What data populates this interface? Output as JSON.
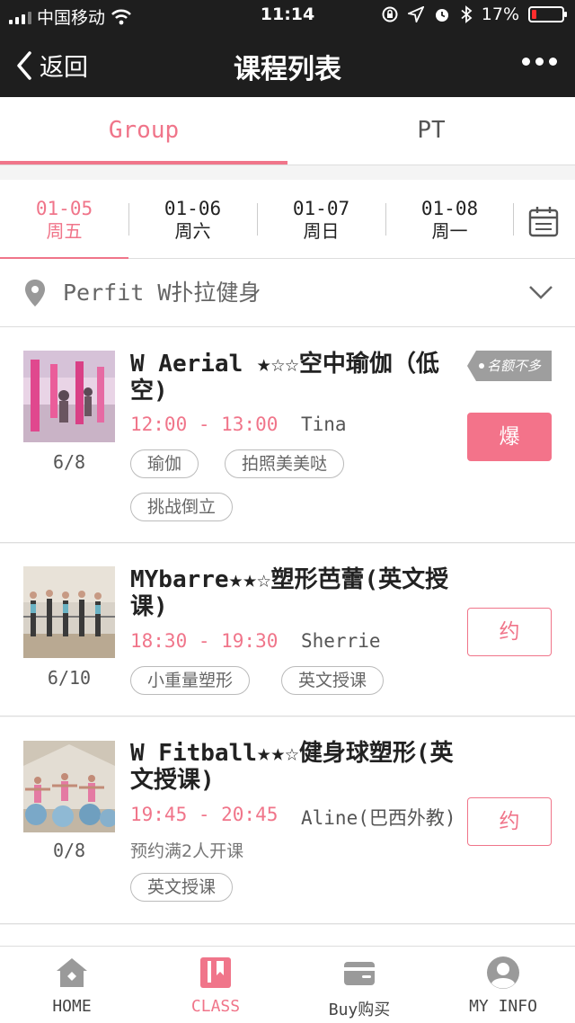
{
  "status_bar": {
    "carrier": "中国移动",
    "time": "11:14",
    "battery": "17%",
    "battery_fraction": 0.17
  },
  "nav": {
    "back_label": "返回",
    "title": "课程列表"
  },
  "tabs": [
    {
      "label": "Group",
      "active": true
    },
    {
      "label": "PT",
      "active": false
    }
  ],
  "dates": [
    {
      "date": "01-05",
      "weekday": "周五",
      "active": true
    },
    {
      "date": "01-06",
      "weekday": "周六",
      "active": false
    },
    {
      "date": "01-07",
      "weekday": "周日",
      "active": false
    },
    {
      "date": "01-08",
      "weekday": "周一",
      "active": false
    }
  ],
  "location": {
    "name": "Perfit W扑拉健身"
  },
  "courses": [
    {
      "title": "W Aerial ★☆☆空中瑜伽（低空)",
      "time": "12:00 - 13:00",
      "coach": "Tina",
      "count": "6/8",
      "badge": "名额不多",
      "button": "爆",
      "tags": [
        "瑜伽",
        "拍照美美哒",
        "挑战倒立"
      ]
    },
    {
      "title": "MYbarre★★☆塑形芭蕾(英文授课)",
      "time": "18:30 - 19:30",
      "coach": "Sherrie",
      "count": "6/10",
      "button": "约",
      "tags": [
        "小重量塑形",
        "英文授课"
      ]
    },
    {
      "title": "W Fitball★★☆健身球塑形(英文授课)",
      "time": "19:45 - 20:45",
      "coach": "Aline(巴西外教)",
      "count": "0/8",
      "note": "预约满2人开课",
      "button": "约",
      "tags": [
        "英文授课"
      ]
    }
  ],
  "bottom_nav": [
    {
      "label": "HOME",
      "icon": "home-icon",
      "active": false
    },
    {
      "label": "CLASS",
      "icon": "book-icon",
      "active": true
    },
    {
      "label": "Buy购买",
      "icon": "wallet-icon",
      "active": false
    },
    {
      "label": "MY INFO",
      "icon": "user-icon",
      "active": false
    }
  ],
  "colors": {
    "accent": "#f0758a",
    "topbar": "#1e1e1e",
    "badge": "#9e9e9e"
  }
}
